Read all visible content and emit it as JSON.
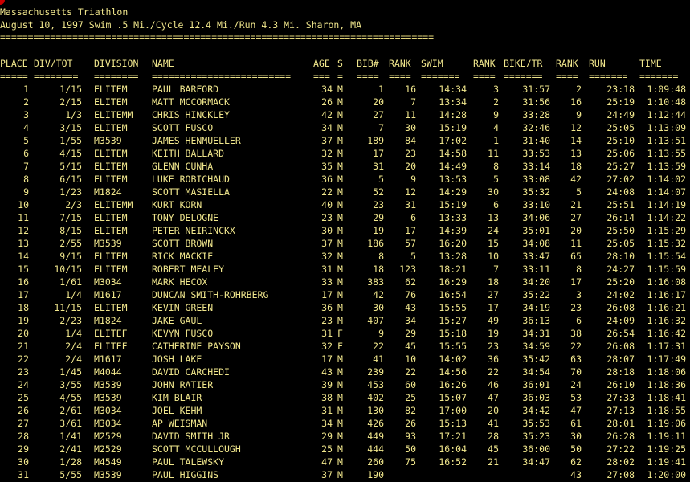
{
  "title": "Massachusetts Triathlon",
  "subtitle": "August 10, 1997 Swim .5 Mi./Cycle 12.4 Mi./Run 4.3 Mi. Sharon, MA",
  "rule": "==============================================================================",
  "headers": {
    "place": "PLACE",
    "divtot": "DIV/TOT",
    "div": "DIVISION",
    "name": "NAME",
    "age": "AGE",
    "s": "S",
    "bib": "BIB#",
    "rank1": "RANK",
    "swim": "SWIM",
    "rank2": "RANK",
    "bike": "BIKE/TR",
    "rank3": "RANK",
    "run": "RUN",
    "time": "TIME"
  },
  "underlines": {
    "place": "=====",
    "divtot": "========",
    "div": "========",
    "name": "=========================",
    "age": "===",
    "s": "=",
    "bib": "====",
    "rank1": "====",
    "swim": "=======",
    "rank2": "====",
    "bike": "=======",
    "rank3": "====",
    "run": "=======",
    "time": "======="
  },
  "rows": [
    [
      "1",
      "1/15",
      "ELITEM",
      "PAUL BARFORD",
      "34",
      "M",
      "1",
      "16",
      "14:34",
      "3",
      "31:57",
      "2",
      "23:18",
      "1:09:48"
    ],
    [
      "2",
      "2/15",
      "ELITEM",
      "MATT MCCORMACK",
      "26",
      "M",
      "20",
      "7",
      "13:34",
      "2",
      "31:56",
      "16",
      "25:19",
      "1:10:48"
    ],
    [
      "3",
      "1/3",
      "ELITEMM",
      "CHRIS HINCKLEY",
      "42",
      "M",
      "27",
      "11",
      "14:28",
      "9",
      "33:28",
      "9",
      "24:49",
      "1:12:44"
    ],
    [
      "4",
      "3/15",
      "ELITEM",
      "SCOTT FUSCO",
      "34",
      "M",
      "7",
      "30",
      "15:19",
      "4",
      "32:46",
      "12",
      "25:05",
      "1:13:09"
    ],
    [
      "5",
      "1/55",
      "M3539",
      "JAMES HENMUELLER",
      "37",
      "M",
      "189",
      "84",
      "17:02",
      "1",
      "31:40",
      "14",
      "25:10",
      "1:13:51"
    ],
    [
      "6",
      "4/15",
      "ELITEM",
      "KEITH BALLARD",
      "32",
      "M",
      "17",
      "23",
      "14:58",
      "11",
      "33:53",
      "13",
      "25:06",
      "1:13:55"
    ],
    [
      "7",
      "5/15",
      "ELITEM",
      "GLENN CUNHA",
      "35",
      "M",
      "31",
      "20",
      "14:49",
      "8",
      "33:14",
      "18",
      "25:27",
      "1:13:59"
    ],
    [
      "8",
      "6/15",
      "ELITEM",
      "LUKE ROBICHAUD",
      "36",
      "M",
      "5",
      "9",
      "13:53",
      "5",
      "33:08",
      "42",
      "27:02",
      "1:14:02"
    ],
    [
      "9",
      "1/23",
      "M1824",
      "SCOTT MASIELLA",
      "22",
      "M",
      "52",
      "12",
      "14:29",
      "30",
      "35:32",
      "5",
      "24:08",
      "1:14:07"
    ],
    [
      "10",
      "2/3",
      "ELITEMM",
      "KURT KORN",
      "40",
      "M",
      "23",
      "31",
      "15:19",
      "6",
      "33:10",
      "21",
      "25:51",
      "1:14:19"
    ],
    [
      "11",
      "7/15",
      "ELITEM",
      "TONY DELOGNE",
      "23",
      "M",
      "29",
      "6",
      "13:33",
      "13",
      "34:06",
      "27",
      "26:14",
      "1:14:22"
    ],
    [
      "12",
      "8/15",
      "ELITEM",
      "PETER NEIRINCKX",
      "30",
      "M",
      "19",
      "17",
      "14:39",
      "24",
      "35:01",
      "20",
      "25:50",
      "1:15:29"
    ],
    [
      "13",
      "2/55",
      "M3539",
      "SCOTT BROWN",
      "37",
      "M",
      "186",
      "57",
      "16:20",
      "15",
      "34:08",
      "11",
      "25:05",
      "1:15:32"
    ],
    [
      "14",
      "9/15",
      "ELITEM",
      "RICK MACKIE",
      "32",
      "M",
      "8",
      "5",
      "13:28",
      "10",
      "33:47",
      "65",
      "28:10",
      "1:15:54"
    ],
    [
      "15",
      "10/15",
      "ELITEM",
      "ROBERT MEALEY",
      "31",
      "M",
      "18",
      "123",
      "18:21",
      "7",
      "33:11",
      "8",
      "24:27",
      "1:15:59"
    ],
    [
      "16",
      "1/61",
      "M3034",
      "MARK HECOX",
      "33",
      "M",
      "383",
      "62",
      "16:29",
      "18",
      "34:20",
      "17",
      "25:20",
      "1:16:08"
    ],
    [
      "17",
      "1/4",
      "M1617",
      "DUNCAN SMITH-ROHRBERG",
      "17",
      "M",
      "42",
      "76",
      "16:54",
      "27",
      "35:22",
      "3",
      "24:02",
      "1:16:17"
    ],
    [
      "18",
      "11/15",
      "ELITEM",
      "KEVIN GREEN",
      "36",
      "M",
      "30",
      "43",
      "15:55",
      "17",
      "34:19",
      "23",
      "26:08",
      "1:16:21"
    ],
    [
      "19",
      "2/23",
      "M1824",
      "JAKE GAUL",
      "23",
      "M",
      "407",
      "34",
      "15:27",
      "49",
      "36:13",
      "6",
      "24:09",
      "1:16:32"
    ],
    [
      "20",
      "1/4",
      "ELITEF",
      "KEVYN FUSCO",
      "31",
      "F",
      "9",
      "29",
      "15:18",
      "19",
      "34:31",
      "38",
      "26:54",
      "1:16:42"
    ],
    [
      "21",
      "2/4",
      "ELITEF",
      "CATHERINE PAYSON",
      "32",
      "F",
      "22",
      "45",
      "15:55",
      "23",
      "34:59",
      "22",
      "26:08",
      "1:17:31"
    ],
    [
      "22",
      "2/4",
      "M1617",
      "JOSH LAKE",
      "17",
      "M",
      "41",
      "10",
      "14:02",
      "36",
      "35:42",
      "63",
      "28:07",
      "1:17:49"
    ],
    [
      "23",
      "1/45",
      "M4044",
      "DAVID CARCHEDI",
      "43",
      "M",
      "239",
      "22",
      "14:56",
      "22",
      "34:54",
      "70",
      "28:18",
      "1:18:06"
    ],
    [
      "24",
      "3/55",
      "M3539",
      "JOHN RATIER",
      "39",
      "M",
      "453",
      "60",
      "16:26",
      "46",
      "36:01",
      "24",
      "26:10",
      "1:18:36"
    ],
    [
      "25",
      "4/55",
      "M3539",
      "KIM BLAIR",
      "38",
      "M",
      "402",
      "25",
      "15:07",
      "47",
      "36:03",
      "53",
      "27:33",
      "1:18:41"
    ],
    [
      "26",
      "2/61",
      "M3034",
      "JOEL KEHM",
      "31",
      "M",
      "130",
      "82",
      "17:00",
      "20",
      "34:42",
      "47",
      "27:13",
      "1:18:55"
    ],
    [
      "27",
      "3/61",
      "M3034",
      "AP WEISMAN",
      "34",
      "M",
      "426",
      "26",
      "15:13",
      "41",
      "35:53",
      "61",
      "28:01",
      "1:19:06"
    ],
    [
      "28",
      "1/41",
      "M2529",
      "DAVID SMITH JR",
      "29",
      "M",
      "449",
      "93",
      "17:21",
      "28",
      "35:23",
      "30",
      "26:28",
      "1:19:11"
    ],
    [
      "29",
      "2/41",
      "M2529",
      "SCOTT MCCULLOUGH",
      "25",
      "M",
      "444",
      "50",
      "16:04",
      "45",
      "36:00",
      "50",
      "27:22",
      "1:19:25"
    ],
    [
      "30",
      "1/28",
      "M4549",
      "PAUL TALEWSKY",
      "47",
      "M",
      "260",
      "75",
      "16:52",
      "21",
      "34:47",
      "62",
      "28:02",
      "1:19:41"
    ],
    [
      "31",
      "5/55",
      "M3539",
      "PAUL HIGGINS",
      "37",
      "M",
      "190",
      "",
      "",
      "",
      "",
      "43",
      "27:08",
      "1:20:00"
    ]
  ]
}
